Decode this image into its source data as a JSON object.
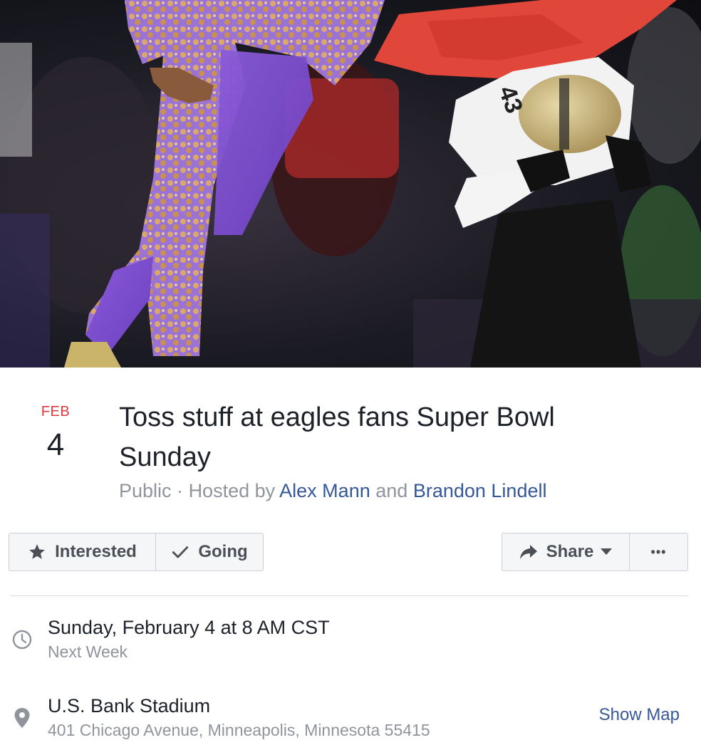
{
  "event": {
    "month": "FEB",
    "day": "4",
    "title": "Toss stuff at eagles fans Super Bowl Sunday",
    "privacy": "Public",
    "hosted_by_prefix": "Hosted by",
    "host_1": "Alex Mann",
    "and": "and",
    "host_2": "Brandon Lindell"
  },
  "actions": {
    "interested_label": "Interested",
    "going_label": "Going",
    "share_label": "Share",
    "more_label": "•••"
  },
  "details": {
    "datetime": "Sunday, February 4 at 8 AM CST",
    "relative_time": "Next Week",
    "venue": "U.S. Bank Stadium",
    "address": "401 Chicago Avenue, Minneapolis, Minnesota 55415",
    "show_map_label": "Show Map"
  },
  "cover": {
    "jersey_number": "43"
  },
  "icons": {
    "interested": "star-icon",
    "going": "check-icon",
    "share": "share-arrow-icon",
    "share_caret": "caret-down-icon",
    "time": "clock-icon",
    "location": "map-pin-icon"
  },
  "colors": {
    "date_month": "#e0393e",
    "link": "#365899",
    "text_primary": "#1d2129",
    "text_secondary": "#90949c",
    "button_bg": "#f5f6f7",
    "button_border": "#ccd0d5"
  }
}
